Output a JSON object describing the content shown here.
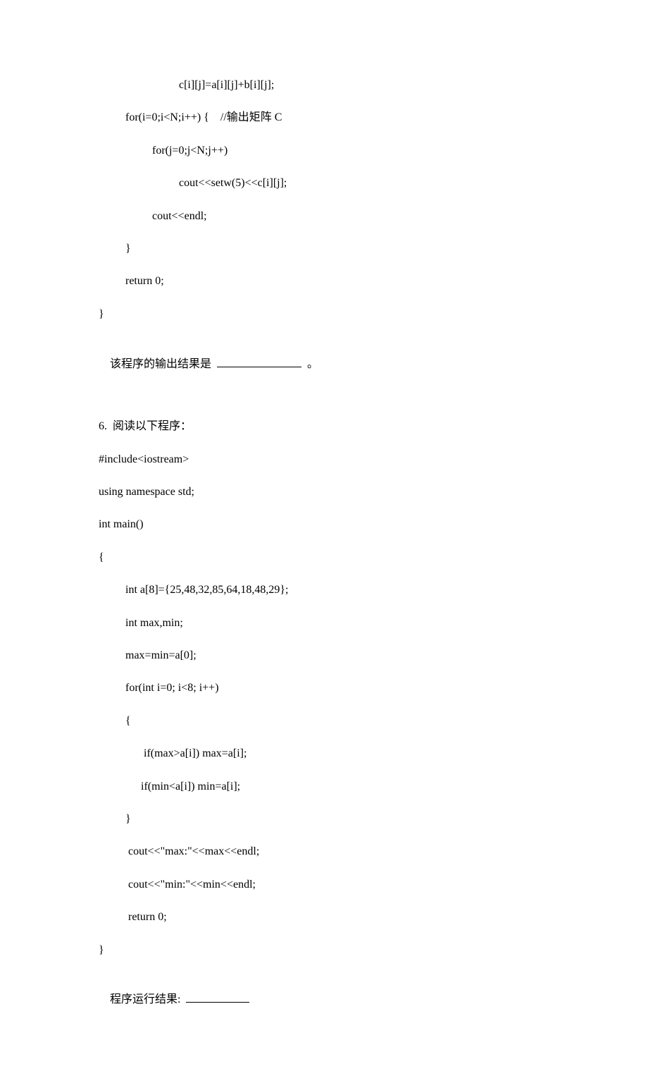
{
  "block1": {
    "l1": "c[i][j]=a[i][j]+b[i][j];",
    "l2": "for(i=0;i<N;i++) {    //输出矩阵 C",
    "l3": "for(j=0;j<N;j++)",
    "l4": "cout<<setw(5)<<c[i][j];",
    "l5": "cout<<endl;",
    "l6": "}",
    "l7": "return 0;",
    "l8": "}",
    "q": "该程序的输出结果是 ",
    "qend": " 。"
  },
  "block2": {
    "title": "6.  阅读以下程序：",
    "l1": "#include<iostream>",
    "l2": "using namespace std;",
    "l3": "int main()",
    "l4": "{",
    "l5": "int a[8]={25,48,32,85,64,18,48,29};",
    "l6": "int max,min;",
    "l7": "max=min=a[0];",
    "l8": "for(int i=0; i<8; i++)",
    "l9": "{",
    "l10": " if(max>a[i]) max=a[i];",
    "l11": "if(min<a[i]) min=a[i];",
    "l12": "}",
    "l13": " cout<<\"max:\"<<max<<endl;",
    "l14": " cout<<\"min:\"<<min<<endl;",
    "l15": " return 0;",
    "l16": "}",
    "q": "程序运行结果: "
  }
}
